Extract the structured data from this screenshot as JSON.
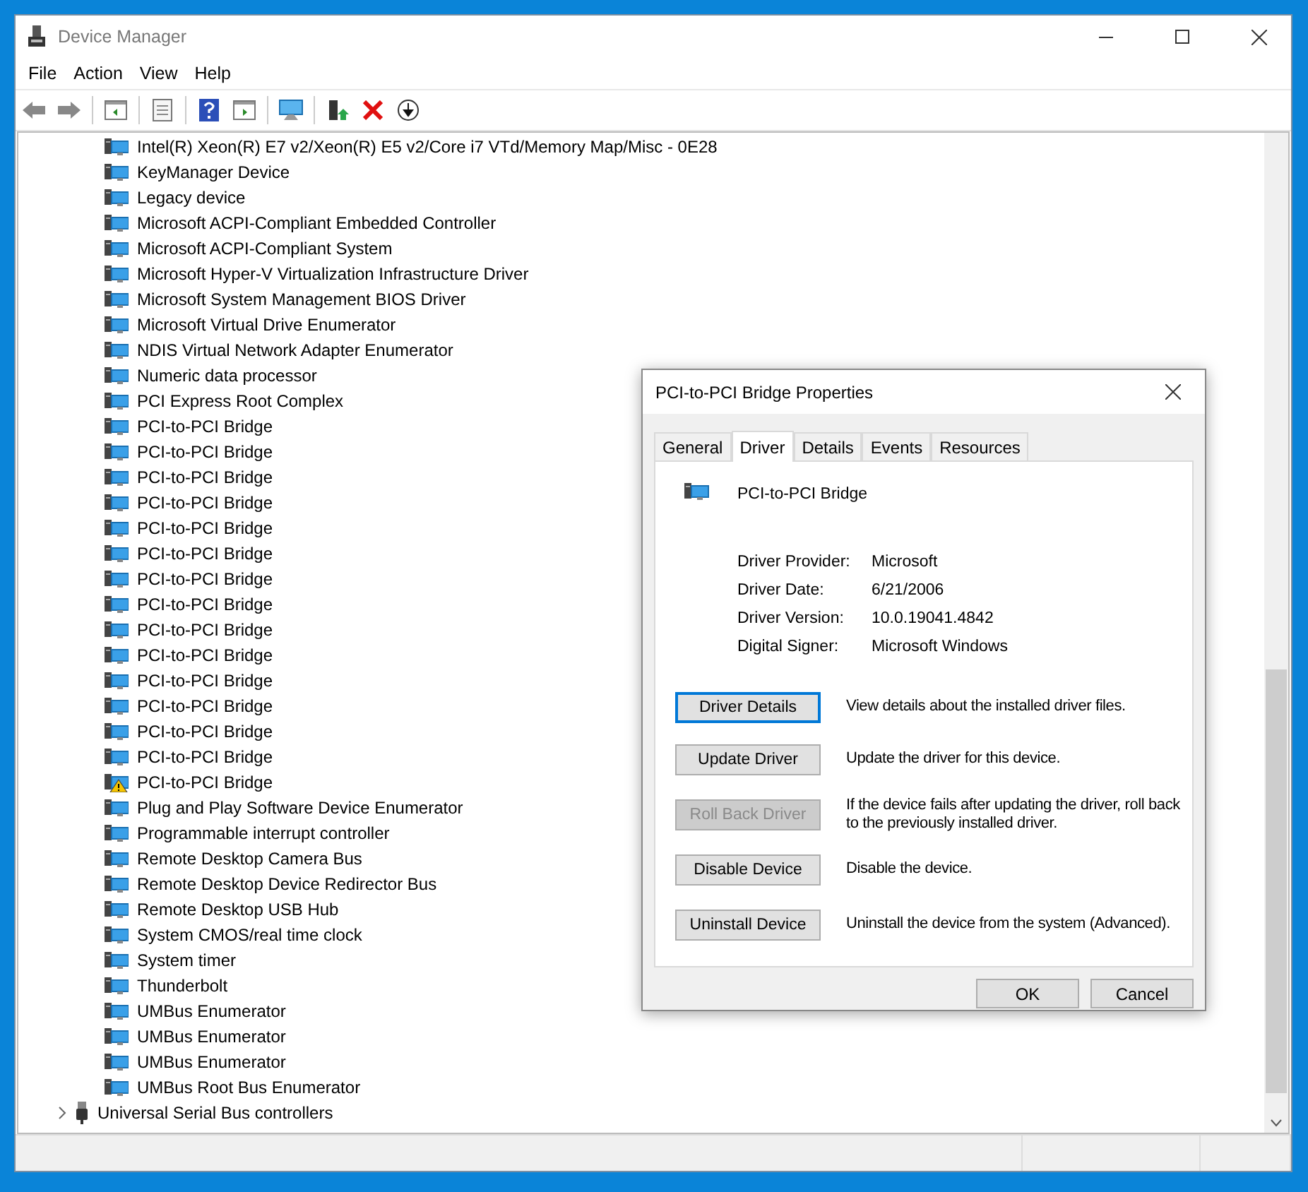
{
  "window": {
    "title": "Device Manager"
  },
  "menu": [
    "File",
    "Action",
    "View",
    "Help"
  ],
  "tree": {
    "devices": [
      {
        "label": "Intel(R) Xeon(R) E7 v2/Xeon(R) E5 v2/Core i7 VTd/Memory Map/Misc - 0E28",
        "kind": "device"
      },
      {
        "label": "KeyManager Device",
        "kind": "device"
      },
      {
        "label": "Legacy device",
        "kind": "device"
      },
      {
        "label": "Microsoft ACPI-Compliant Embedded Controller",
        "kind": "device"
      },
      {
        "label": "Microsoft ACPI-Compliant System",
        "kind": "device"
      },
      {
        "label": "Microsoft Hyper-V Virtualization Infrastructure Driver",
        "kind": "device"
      },
      {
        "label": "Microsoft System Management BIOS Driver",
        "kind": "device"
      },
      {
        "label": "Microsoft Virtual Drive Enumerator",
        "kind": "device"
      },
      {
        "label": "NDIS Virtual Network Adapter Enumerator",
        "kind": "device"
      },
      {
        "label": "Numeric data processor",
        "kind": "device"
      },
      {
        "label": "PCI Express Root Complex",
        "kind": "device"
      },
      {
        "label": "PCI-to-PCI Bridge",
        "kind": "device"
      },
      {
        "label": "PCI-to-PCI Bridge",
        "kind": "device"
      },
      {
        "label": "PCI-to-PCI Bridge",
        "kind": "device"
      },
      {
        "label": "PCI-to-PCI Bridge",
        "kind": "device"
      },
      {
        "label": "PCI-to-PCI Bridge",
        "kind": "device"
      },
      {
        "label": "PCI-to-PCI Bridge",
        "kind": "device"
      },
      {
        "label": "PCI-to-PCI Bridge",
        "kind": "device"
      },
      {
        "label": "PCI-to-PCI Bridge",
        "kind": "device"
      },
      {
        "label": "PCI-to-PCI Bridge",
        "kind": "device"
      },
      {
        "label": "PCI-to-PCI Bridge",
        "kind": "device"
      },
      {
        "label": "PCI-to-PCI Bridge",
        "kind": "device"
      },
      {
        "label": "PCI-to-PCI Bridge",
        "kind": "device"
      },
      {
        "label": "PCI-to-PCI Bridge",
        "kind": "device"
      },
      {
        "label": "PCI-to-PCI Bridge",
        "kind": "device"
      },
      {
        "label": "PCI-to-PCI Bridge",
        "kind": "warning"
      },
      {
        "label": "Plug and Play Software Device Enumerator",
        "kind": "device"
      },
      {
        "label": "Programmable interrupt controller",
        "kind": "device"
      },
      {
        "label": "Remote Desktop Camera Bus",
        "kind": "device"
      },
      {
        "label": "Remote Desktop Device Redirector Bus",
        "kind": "device"
      },
      {
        "label": "Remote Desktop USB Hub",
        "kind": "device"
      },
      {
        "label": "System CMOS/real time clock",
        "kind": "device"
      },
      {
        "label": "System timer",
        "kind": "device"
      },
      {
        "label": "Thunderbolt",
        "kind": "device"
      },
      {
        "label": "UMBus Enumerator",
        "kind": "device"
      },
      {
        "label": "UMBus Enumerator",
        "kind": "device"
      },
      {
        "label": "UMBus Enumerator",
        "kind": "device"
      },
      {
        "label": "UMBus Root Bus Enumerator",
        "kind": "device"
      }
    ],
    "categories": [
      {
        "label": "Universal Serial Bus controllers",
        "expanded": false
      }
    ]
  },
  "dialog": {
    "title": "PCI-to-PCI Bridge Properties",
    "tabs": [
      {
        "label": "General",
        "selected": false
      },
      {
        "label": "Driver",
        "selected": true
      },
      {
        "label": "Details",
        "selected": false
      },
      {
        "label": "Events",
        "selected": false
      },
      {
        "label": "Resources",
        "selected": false
      }
    ],
    "device_name": "PCI-to-PCI Bridge",
    "properties": [
      {
        "label": "Driver Provider:",
        "value": "Microsoft"
      },
      {
        "label": "Driver Date:",
        "value": "6/21/2006"
      },
      {
        "label": "Driver Version:",
        "value": "10.0.19041.4842"
      },
      {
        "label": "Digital Signer:",
        "value": "Microsoft Windows"
      }
    ],
    "actions": [
      {
        "button": "Driver Details",
        "description": "View details about the installed driver files.",
        "disabled": false,
        "focused": true
      },
      {
        "button": "Update Driver",
        "description": "Update the driver for this device.",
        "disabled": false,
        "focused": false
      },
      {
        "button": "Roll Back Driver",
        "description": "If the device fails after updating the driver, roll back to the previously installed driver.",
        "disabled": true,
        "focused": false
      },
      {
        "button": "Disable Device",
        "description": "Disable the device.",
        "disabled": false,
        "focused": false
      },
      {
        "button": "Uninstall Device",
        "description": "Uninstall the device from the system (Advanced).",
        "disabled": false,
        "focused": false
      }
    ],
    "buttons": [
      "OK",
      "Cancel"
    ]
  }
}
